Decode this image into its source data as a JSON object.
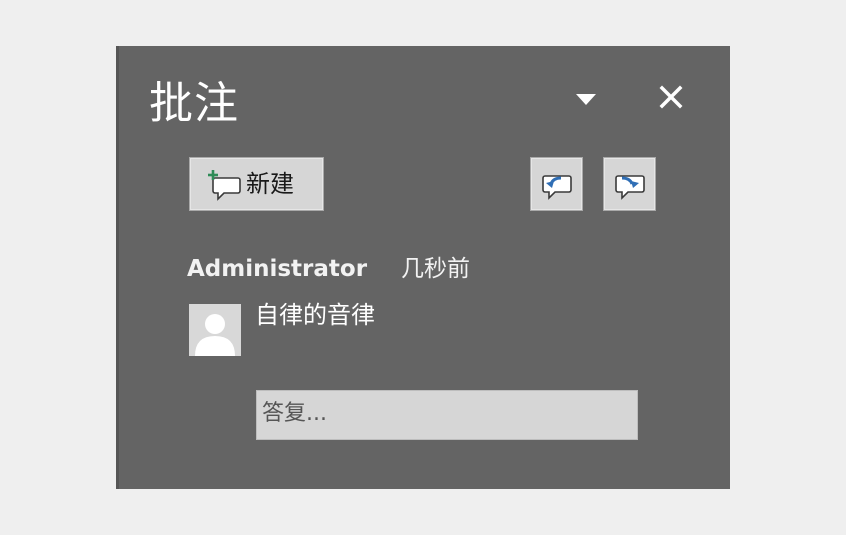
{
  "pane": {
    "title": "批注",
    "options_icon": "dropdown-triangle-icon",
    "close_icon": "close-icon"
  },
  "toolbar": {
    "new_label": "新建",
    "new_icon": "new-comment-icon",
    "prev_icon": "previous-comment-icon",
    "next_icon": "next-comment-icon"
  },
  "comment": {
    "author": "Administrator",
    "time": "几秒前",
    "text": "自律的音律",
    "avatar_icon": "default-user-icon"
  },
  "reply": {
    "placeholder": "答复..."
  },
  "colors": {
    "pane_background": "#646464",
    "page_background": "#efefef",
    "button_background": "#d6d6d6",
    "accent_green": "#2e8b57",
    "accent_blue": "#2f6eb5"
  }
}
